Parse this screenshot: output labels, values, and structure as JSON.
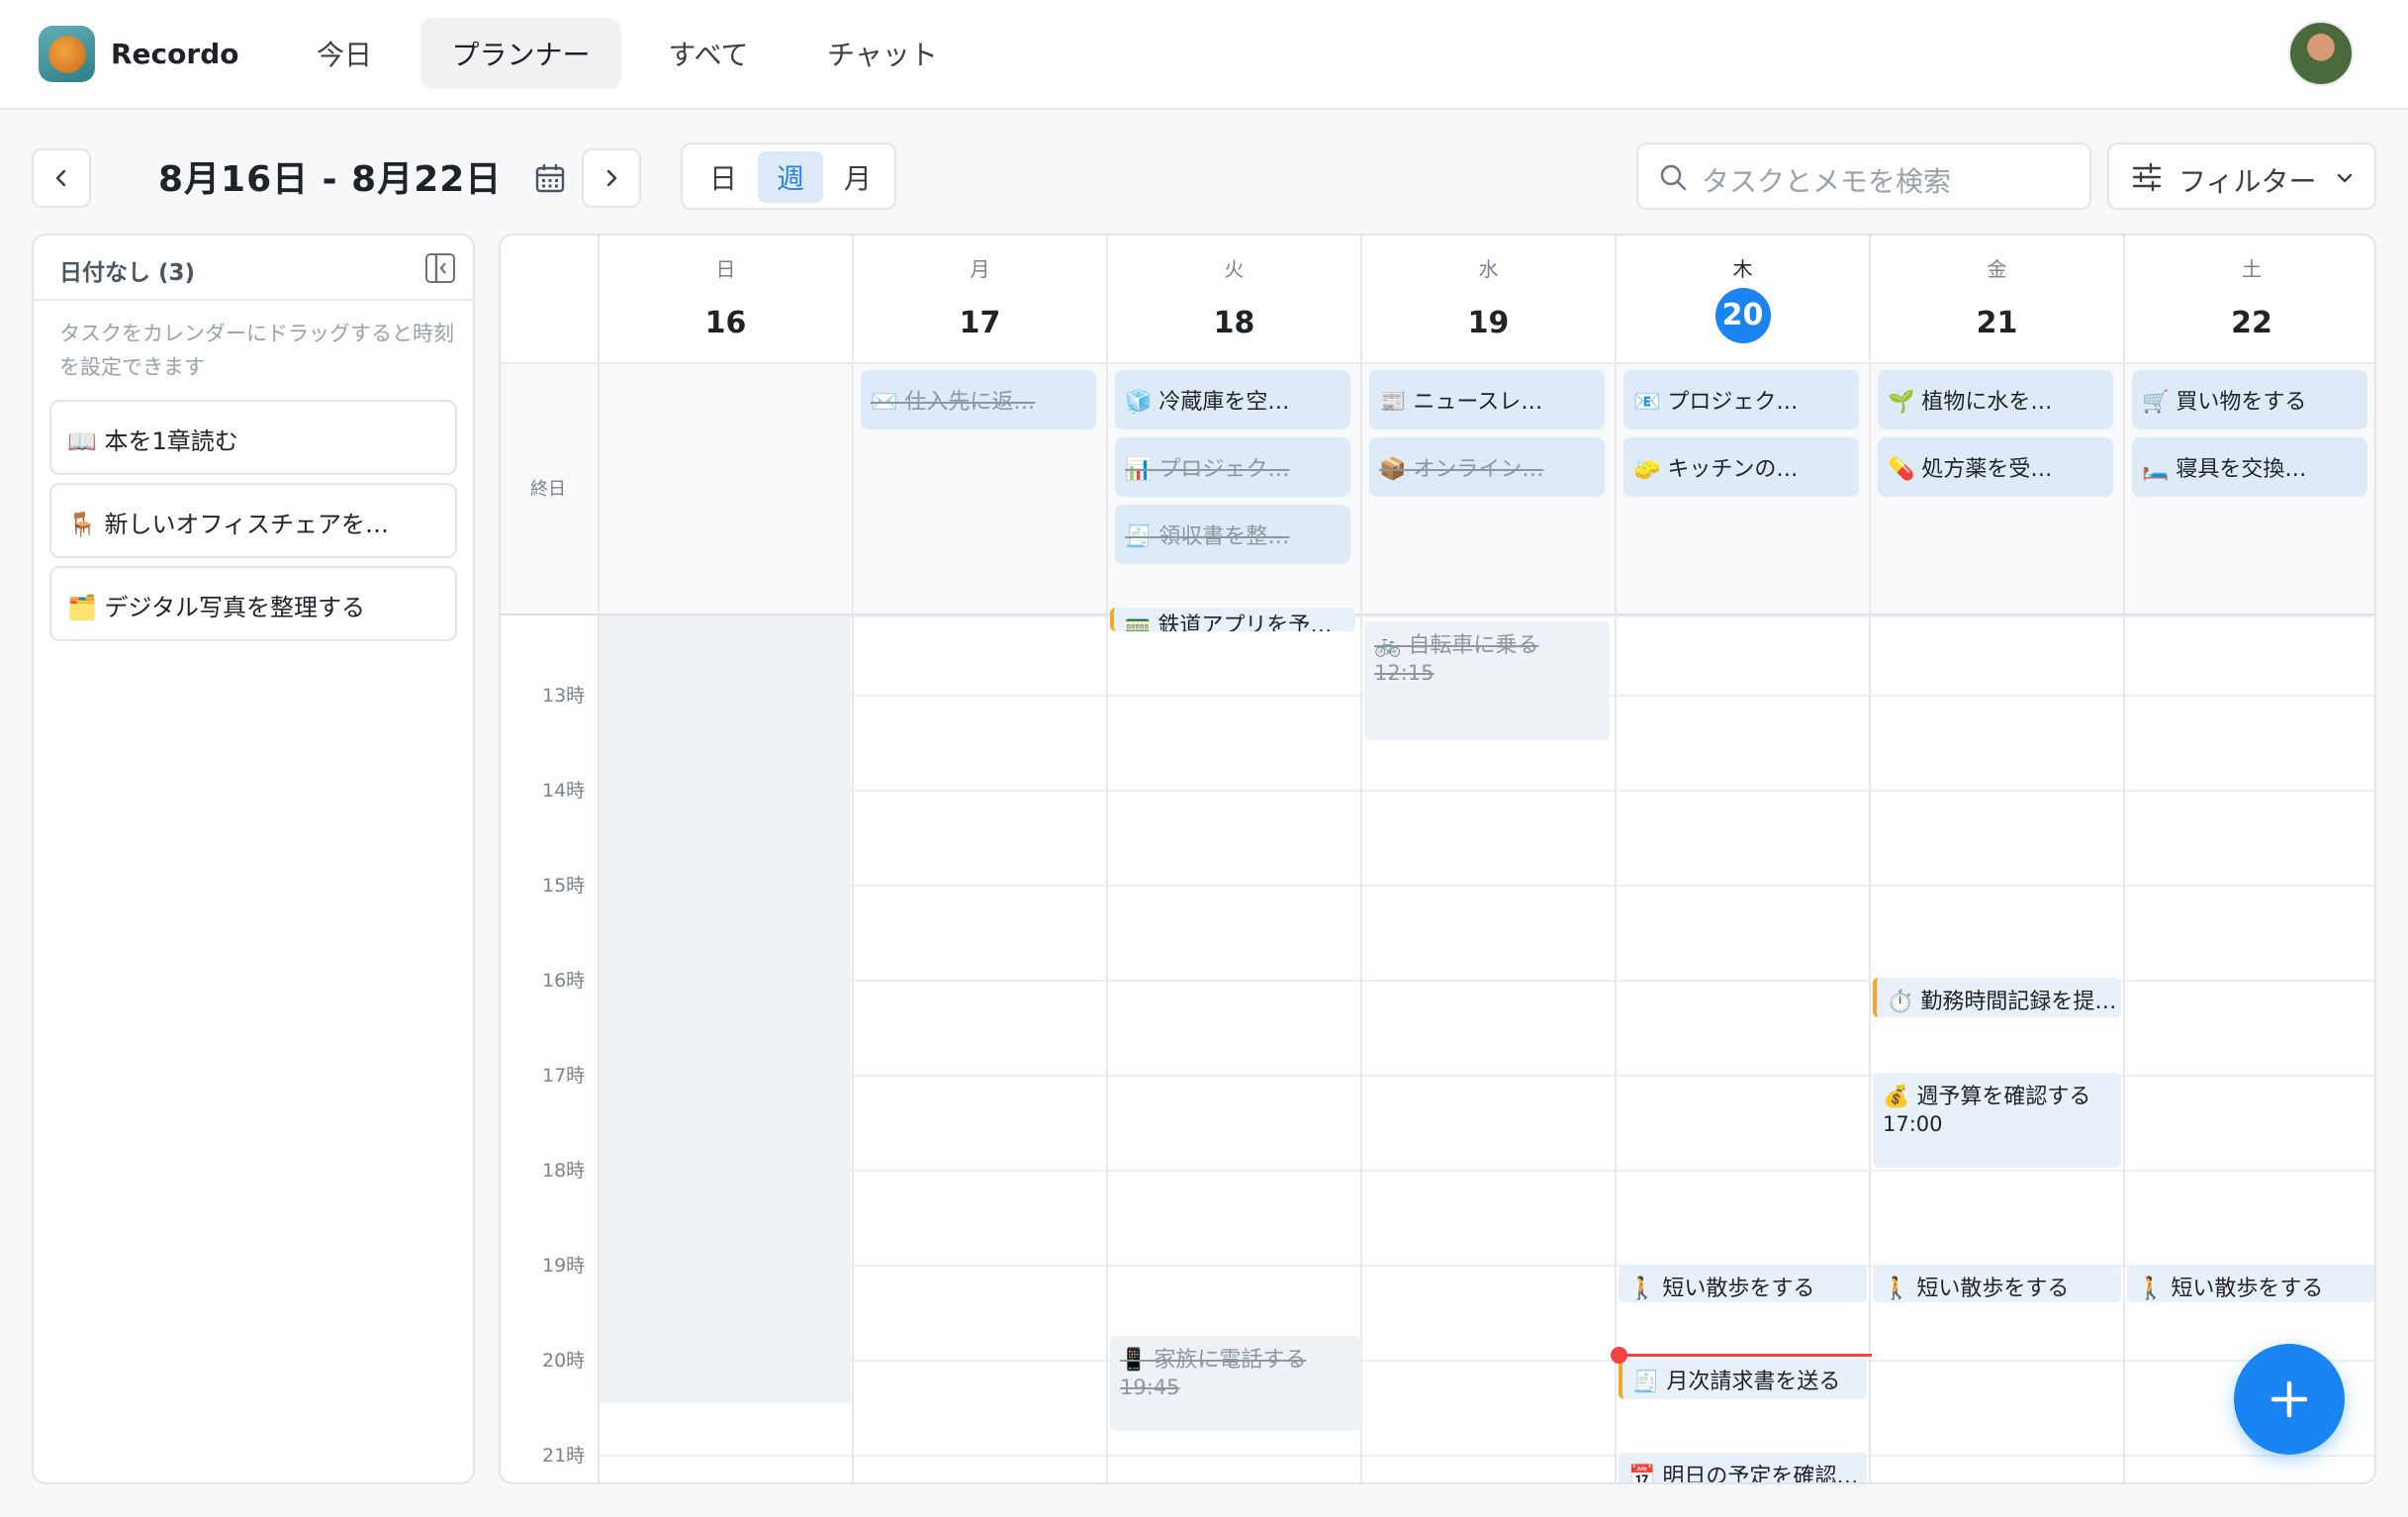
{
  "app": {
    "name": "Recordo"
  },
  "nav": {
    "tabs": [
      "今日",
      "プランナー",
      "すべて",
      "チャット"
    ]
  },
  "toolbar": {
    "range": "8月16日 - 8月22日",
    "views": [
      "日",
      "週",
      "月"
    ],
    "search_placeholder": "タスクとメモを検索",
    "filter_label": "フィルター"
  },
  "sidebar": {
    "title": "日付なし (3)",
    "hint": "タスクをカレンダーにドラッグすると時刻を設定できます",
    "items": [
      "📖 本を1章読む",
      "🪑 新しいオフィスチェアを…",
      "🗂️ デジタル写真を整理する"
    ]
  },
  "calendar": {
    "allday_label": "終日",
    "days": [
      {
        "dow": "日",
        "num": "16"
      },
      {
        "dow": "月",
        "num": "17"
      },
      {
        "dow": "火",
        "num": "18"
      },
      {
        "dow": "水",
        "num": "19"
      },
      {
        "dow": "木",
        "num": "20"
      },
      {
        "dow": "金",
        "num": "21"
      },
      {
        "dow": "土",
        "num": "22"
      }
    ],
    "hours": [
      "13時",
      "14時",
      "15時",
      "16時",
      "17時",
      "18時",
      "19時",
      "20時",
      "21時"
    ],
    "allday_chips": [
      "✉️ 仕入先に返…",
      "🧊 冷蔵庫を空…",
      "📊 プロジェク…",
      "🧾 領収書を整…",
      "📰 ニュースレ…",
      "📦 オンライン…",
      "📧 プロジェク…",
      "🧽 キッチンの…",
      "🌱 植物に水を…",
      "💊 処方薬を受…",
      "🛒 買い物をする",
      "🛏️ 寝具を交換…"
    ],
    "events": [
      {
        "title": "🚃 鉄道アプリを予…"
      },
      {
        "title": "🚲 自転車に乗る",
        "time": "12:15"
      },
      {
        "title": "⏱️ 勤務時間記録を提…"
      },
      {
        "title": "💰 週予算を確認する",
        "time": "17:00"
      },
      {
        "title": "🚶 短い散歩をする"
      },
      {
        "title": "🚶 短い散歩をする"
      },
      {
        "title": "🚶 短い散歩をする"
      },
      {
        "title": "📱 家族に電話する",
        "time": "19:45"
      },
      {
        "title": "🧾 月次請求書を送る"
      },
      {
        "title": "📅 明日の予定を確認…"
      }
    ]
  },
  "colors": {
    "accent": "#1a84f2",
    "today": "#1a84f2",
    "now_line": "#ef4444",
    "task_accent": "#f5a623"
  }
}
